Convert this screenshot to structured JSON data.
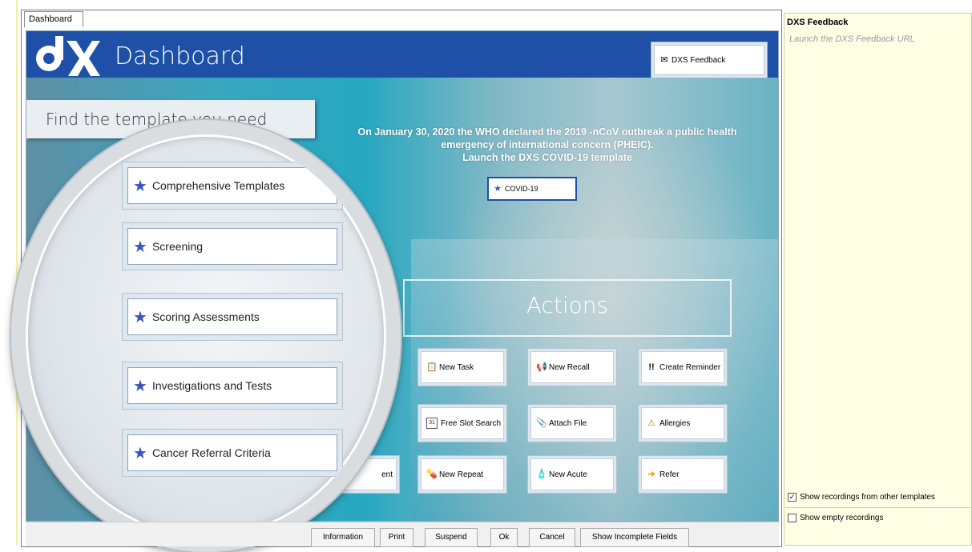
{
  "tab": {
    "label": "Dashboard"
  },
  "header": {
    "title": "Dashboard",
    "feedback_button": "DXS Feedback"
  },
  "find": {
    "text": "Find the template you need"
  },
  "announcement": {
    "line1": "On January 30, 2020 the WHO declared the 2019 -nCoV outbreak a public health",
    "line2": "emergency of international concern (PHEIC).",
    "line3": "Launch the DXS COVID-19 template",
    "button": "COVID-19"
  },
  "magnifier": {
    "items": [
      {
        "label": "Comprehensive Templates"
      },
      {
        "label": "Screening"
      },
      {
        "label": "Scoring Assessments"
      },
      {
        "label": "Investigations and Tests"
      },
      {
        "label": "Cancer Referral Criteria"
      }
    ]
  },
  "actions": {
    "title": "Actions",
    "buttons": [
      {
        "label": "New Task",
        "icon": "clipboard-icon"
      },
      {
        "label": "New Recall",
        "icon": "megaphone-icon"
      },
      {
        "label": "Create Reminder",
        "icon": "exclamation-icon"
      },
      {
        "label": "Free Slot Search",
        "icon": "calendar-icon"
      },
      {
        "label": "Attach File",
        "icon": "paperclip-icon"
      },
      {
        "label": "Allergies",
        "icon": "allergy-icon"
      },
      {
        "label": "New Repeat",
        "icon": "pills-icon"
      },
      {
        "label": "New Acute",
        "icon": "bottle-icon"
      },
      {
        "label": "Refer",
        "icon": "arrow-right-icon"
      }
    ],
    "partial_label": "ent"
  },
  "bottom_bar": {
    "information": "Information",
    "print": "Print",
    "suspend": "Suspend",
    "ok": "Ok",
    "cancel": "Cancel",
    "show_incomplete": "Show Incomplete Fields"
  },
  "right_panel": {
    "title": "DXS Feedback",
    "description": "Launch the DXS Feedback URL",
    "show_recordings": {
      "label": "Show recordings from other templates",
      "checked": true
    },
    "show_empty": {
      "label": "Show empty recordings",
      "checked": false
    }
  },
  "colors": {
    "header_blue": "#1d50a6",
    "panel_bg": "#ffffe6",
    "star": "#3957b8",
    "refer_arrow": "#f59c1a"
  }
}
